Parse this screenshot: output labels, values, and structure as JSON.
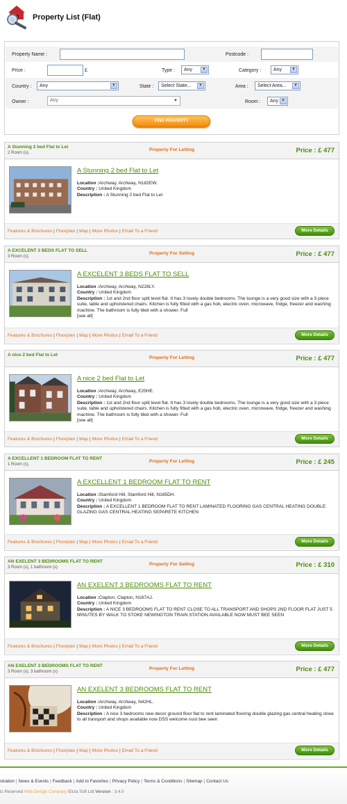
{
  "header": {
    "title": "Property List (Flat)",
    "icon": "house-search-icon"
  },
  "search": {
    "property_name_label": "Property Name :",
    "postcode_label": "Postcode :",
    "price_label": "Price :",
    "currency": "£",
    "type_label": "Type :",
    "type_value": "Any",
    "category_label": "Category :",
    "category_value": "Any",
    "country_label": "Country :",
    "country_value": "Any",
    "state_label": "State :",
    "state_value": "Select State...",
    "area_label": "Area :",
    "area_value": "Select Area...",
    "owner_label": "Owner :",
    "owner_value": "Any",
    "room_label": "Room :",
    "room_value": "Any",
    "find_button": "FIND PROPERTY"
  },
  "listings": [
    {
      "title": "A Stunning 2 bed Flat to Let",
      "rooms": "2 Room (s),",
      "type": "Property For Letting",
      "price": "Price : £ 477",
      "heading": "A Stunning 2 bed Flat to Let",
      "location": "Archway, Archway, N182EW.",
      "country": "United Kingdom",
      "description": "A Stunning 2 bed Flat to Let",
      "see_all": ""
    },
    {
      "title": "A EXCELENT 3 BEDS FLAT TO SELL",
      "rooms": "3 Room (s),",
      "type": "Property For Selling",
      "price": "Price : £ 477",
      "heading": "A EXCELENT 3 BEDS FLAT TO SELL",
      "location": "Archway, Archway, N228LY.",
      "country": "United Kingdom",
      "description": "1st and 2nd floor split level flat. It has 3 lovely double bedrooms. The lounge is a very good size with a 3 piece suite, table and upholstered chairs. Kitchen is fully fitted with a gas hob, electric oven, microwave, fridge, freezer and washing machine. The bathroom is fully tiled with a shower. Full",
      "see_all": "[see all]"
    },
    {
      "title": "A nice 2 bed Flat to Let",
      "rooms": "",
      "type": "Property For Letting",
      "price": "Price : £ 477",
      "heading": "A nice 2 bed Flat to Let",
      "location": "Archway, Archway, E25HE.",
      "country": "United Kingdom",
      "description": "1st and 2nd floor split level flat. It has 3 lovely double bedrooms. The lounge is a very good size with a 3 piece suite, table and upholstered chairs. Kitchen is fully fitted with a gas hob, electric oven, microwave, fridge, freezer and washing machine. The bathroom is fully tiled with a shower. Full",
      "see_all": "[see all]"
    },
    {
      "title": "A EXCELLENT 1 BEDROOM FLAT TO RENT",
      "rooms": "1 Room (s),",
      "type": "Property For Letting",
      "price": "Price : £ 245",
      "heading": "A EXCELLENT 1 BEDROOM FLAT TO RENT",
      "location": "Stamford Hill, Stamford Hill, N165DH.",
      "country": "United Kingdom",
      "description": "A EXCELLENT 1 BEDROOM FLAT TO RENT LAMINATED FLOORING GAS CENTRAL HEATING DOUBLE GLAZING GAS CENTRAL HEATING SEPARETE KITCHEN",
      "see_all": ""
    },
    {
      "title": "AN EXELENT 3 BEDROOMS FLAT TO RENT",
      "rooms": "3 Room (s), 1 bathroom (s)",
      "type": "Property For Selling",
      "price": "Price : £ 310",
      "heading": "AN EXELENT 3 BEDROOMS FLAT TO RENT",
      "location": "Clapton, Clapton, N167AJ.",
      "country": "United Kingdom",
      "description": "A NICE 3 BEDROOMS FLAT TO RENT CLOSE TO ALL TRANSPORT AND SHOPS 2ND FLOOR FLAT JUST 5 MINUTES BY WALK TO STOKE NEWINGTON TRAIN STATION AVAILABLE NOW MUST BEE SEEN",
      "see_all": ""
    },
    {
      "title": "AN EXELENT 3 BEDROOMS FLAT TO RENT",
      "rooms": "3 Room (s), 3 bathroom (s)",
      "type": "Property For Letting",
      "price": "Price : £ 477",
      "heading": "AN EXELENT 3 BEDROOMS FLAT TO RENT",
      "location": "Archway, Archway, N42HL.",
      "country": "United Kingdom",
      "description": "A nice 3 bedrooms new decor ground floor flat to rent laminated flooring double glazing gas central heating close to all transport and shops available now DSS welcome nust bee seen",
      "see_all": ""
    }
  ],
  "common": {
    "location_label": "Location :",
    "country_label": "Country :",
    "description_label": "Description :",
    "links": [
      "Features & Brochures",
      "Floorplan",
      "Map",
      "More Photos",
      "Email To a Friend"
    ],
    "more_details": "More Details"
  },
  "footer": {
    "links": [
      "stration",
      "News & Events",
      "Feedback",
      "Add to Favorites",
      "Privacy Policy",
      "Terms & Conditions",
      "Sitemap",
      "Contact Us"
    ],
    "copyright_start": "ts Reserved",
    "copyright_highlight": "Web Design Company",
    "copyright_end": "Eicra Soft Ltd",
    "version_label": "Version",
    "version": ": 3.4.0"
  },
  "colors": {
    "green": "#4a8c08",
    "orange": "#e46b0f"
  }
}
